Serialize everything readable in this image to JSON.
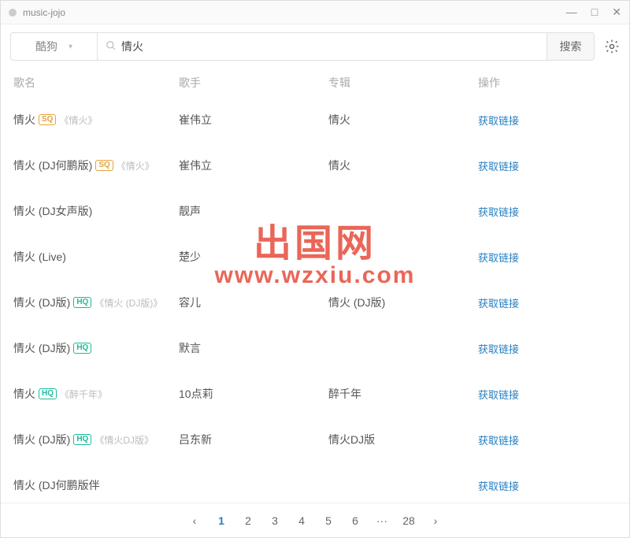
{
  "window": {
    "title": "music-jojo"
  },
  "search": {
    "source_label": "酷狗",
    "query": "情火",
    "button": "搜索"
  },
  "columns": {
    "name": "歌名",
    "artist": "歌手",
    "album": "专辑",
    "action": "操作"
  },
  "action_label": "获取链接",
  "rows": [
    {
      "title": "情火",
      "badge": "SQ",
      "extra": "《情火》",
      "artist": "崔伟立",
      "album": "情火"
    },
    {
      "title": "情火 (DJ何鹏版)",
      "badge": "SQ",
      "extra": "《情火》",
      "artist": "崔伟立",
      "album": "情火"
    },
    {
      "title": "情火 (DJ女声版)",
      "badge": "",
      "extra": "",
      "artist": "靓声",
      "album": ""
    },
    {
      "title": "情火 (Live)",
      "badge": "",
      "extra": "",
      "artist": "楚少",
      "album": ""
    },
    {
      "title": "情火 (DJ版)",
      "badge": "HQ",
      "extra": "《情火 (DJ版)》",
      "artist": "容儿",
      "album": "情火 (DJ版)"
    },
    {
      "title": "情火 (DJ版)",
      "badge": "HQ",
      "extra": "",
      "artist": "默言",
      "album": ""
    },
    {
      "title": "情火",
      "badge": "HQ",
      "extra": "《醉千年》",
      "artist": "10点莉",
      "album": "醉千年"
    },
    {
      "title": "情火 (DJ版)",
      "badge": "HQ",
      "extra": "《情火DJ版》",
      "artist": "吕东新",
      "album": "情火DJ版"
    },
    {
      "title": "情火 (DJ何鹏版伴",
      "badge": "",
      "extra": "",
      "artist": "",
      "album": ""
    }
  ],
  "pagination": {
    "pages": [
      "1",
      "2",
      "3",
      "4",
      "5",
      "6",
      "···",
      "28"
    ],
    "current": "1",
    "prev": "‹",
    "next": "›"
  },
  "watermark": {
    "line1": "出国网",
    "line2": "www.wzxiu.com"
  }
}
